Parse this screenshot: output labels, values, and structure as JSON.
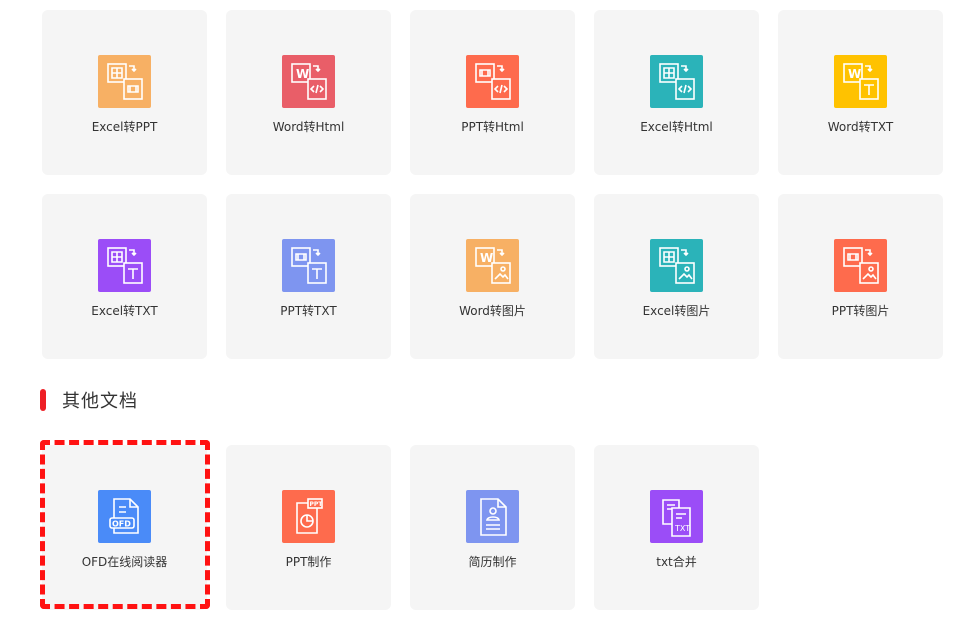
{
  "rows": [
    [
      {
        "label": "Excel转PPT",
        "icon": "excel-to-ppt-icon",
        "color": "#F7B064"
      },
      {
        "label": "Word转Html",
        "icon": "word-to-html-icon",
        "color": "#E95E68"
      },
      {
        "label": "PPT转Html",
        "icon": "ppt-to-html-icon",
        "color": "#FE6B4D"
      },
      {
        "label": "Excel转Html",
        "icon": "excel-to-html-icon",
        "color": "#2BB3B9"
      },
      {
        "label": "Word转TXT",
        "icon": "word-to-txt-icon",
        "color": "#FFC200"
      }
    ],
    [
      {
        "label": "Excel转TXT",
        "icon": "excel-to-txt-icon",
        "color": "#9B4DF7"
      },
      {
        "label": "PPT转TXT",
        "icon": "ppt-to-txt-icon",
        "color": "#7E95F0"
      },
      {
        "label": "Word转图片",
        "icon": "word-to-image-icon",
        "color": "#F7B064"
      },
      {
        "label": "Excel转图片",
        "icon": "excel-to-image-icon",
        "color": "#2BB3B9"
      },
      {
        "label": "PPT转图片",
        "icon": "ppt-to-image-icon",
        "color": "#FE6B4D"
      }
    ]
  ],
  "section": {
    "title": "其他文档",
    "accent": "#EE1F25"
  },
  "other": [
    {
      "label": "OFD在线阅读器",
      "icon": "ofd-reader-icon",
      "color": "#4A8BF8"
    },
    {
      "label": "PPT制作",
      "icon": "ppt-maker-icon",
      "color": "#FE6B4D"
    },
    {
      "label": "简历制作",
      "icon": "resume-maker-icon",
      "color": "#7E95F0"
    },
    {
      "label": "txt合并",
      "icon": "txt-merge-icon",
      "color": "#9B4DF7"
    }
  ],
  "highlight_color": "#FF1212"
}
